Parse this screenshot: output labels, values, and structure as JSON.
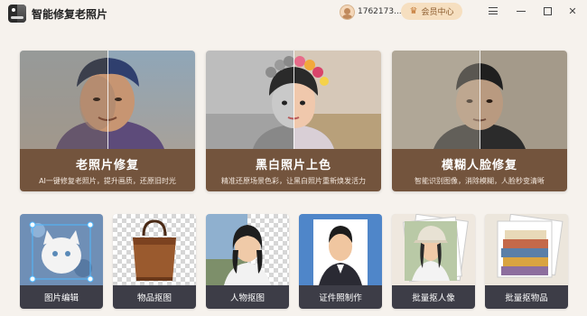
{
  "app": {
    "title": "智能修复老照片"
  },
  "header": {
    "user_id": "1762173...",
    "vip_label": "会员中心"
  },
  "icons": {
    "app_logo": "app-logo-icon",
    "avatar": "user-avatar-icon",
    "vip": "crown-icon",
    "menu": "menu-icon",
    "minimize": "minimize-icon",
    "maximize": "maximize-icon",
    "close": "close-icon"
  },
  "colors": {
    "background": "#f6f2ed",
    "feature_caption": "#73543d",
    "tool_caption": "#3d3d47",
    "vip_bg": "#f6dfc0",
    "vip_text": "#8a5a2b"
  },
  "features": [
    {
      "title": "老照片修复",
      "subtitle": "AI一键修复老照片，提升画质，还原旧时光"
    },
    {
      "title": "黑白照片上色",
      "subtitle": "精准还原场景色彩，让黑白照片重新焕发活力"
    },
    {
      "title": "模糊人脸修复",
      "subtitle": "智能识别图像，消除模糊，人脸秒变清晰"
    }
  ],
  "tools": [
    {
      "label": "图片编辑"
    },
    {
      "label": "物品抠图"
    },
    {
      "label": "人物抠图"
    },
    {
      "label": "证件照制作"
    },
    {
      "label": "批量抠人像"
    },
    {
      "label": "批量抠物品"
    }
  ]
}
